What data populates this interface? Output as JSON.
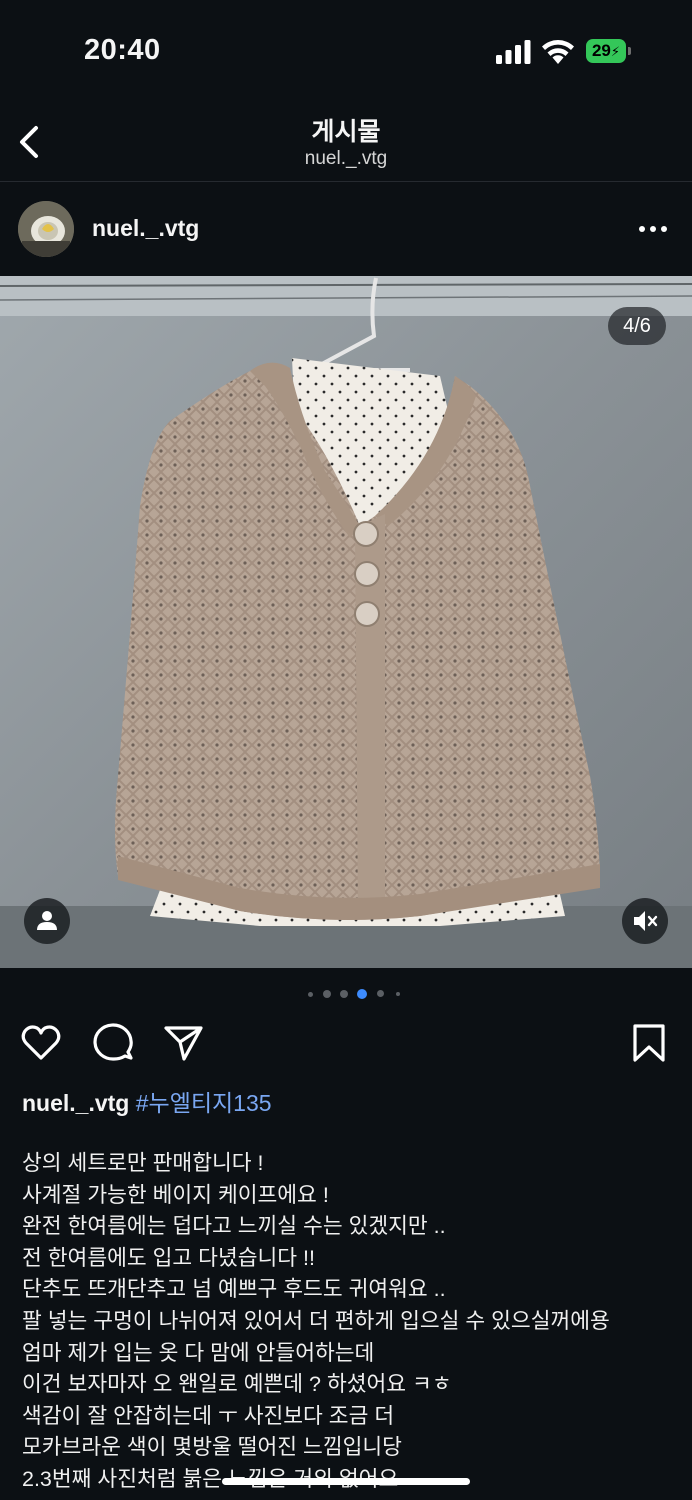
{
  "status_bar": {
    "time": "20:40",
    "battery": "29"
  },
  "nav": {
    "title": "게시물",
    "subtitle": "nuel._.vtg"
  },
  "post": {
    "username": "nuel._.vtg",
    "media_counter": "4/6",
    "carousel": {
      "total_dots": 6,
      "active_index": 3
    }
  },
  "caption": {
    "username": "nuel._.vtg",
    "hashtag": "#누엘티지135",
    "lines": [
      "상의 세트로만 판매합니다 !",
      "사계절 가능한 베이지 케이프에요 !",
      "완전 한여름에는 덥다고 느끼실 수는 있겠지만 ..",
      "전 한여름에도 입고 다녔습니다 !!",
      "단추도 뜨개단추고 넘 예쁘구 후드도 귀여워요 ..",
      "팔 넣는 구멍이 나뉘어져 있어서 더 편하게 입으실 수 있으실꺼에용",
      "엄마 제가 입는 옷 다 맘에 안들어하는데",
      "이건 보자마자 오 왠일로 예쁜데 ? 하셨어요 ㅋㅎ",
      "색감이 잘 안잡히는데 ㅜ 사진보다 조금 더",
      "모카브라운 색이 몇방울 떨어진 느낌입니당",
      "2.3번째 사진처럼 붉은 느낌은 거의 없어요"
    ]
  },
  "icons": {
    "back": "chevron-left-icon",
    "more": "more-horizontal-icon",
    "like": "heart-icon",
    "comment": "comment-icon",
    "share": "send-icon",
    "save": "bookmark-icon",
    "tag": "person-icon",
    "mute": "speaker-muted-icon"
  },
  "colors": {
    "background": "#0c1014",
    "hashtag": "#7aa7f2",
    "battery": "#34c759"
  }
}
